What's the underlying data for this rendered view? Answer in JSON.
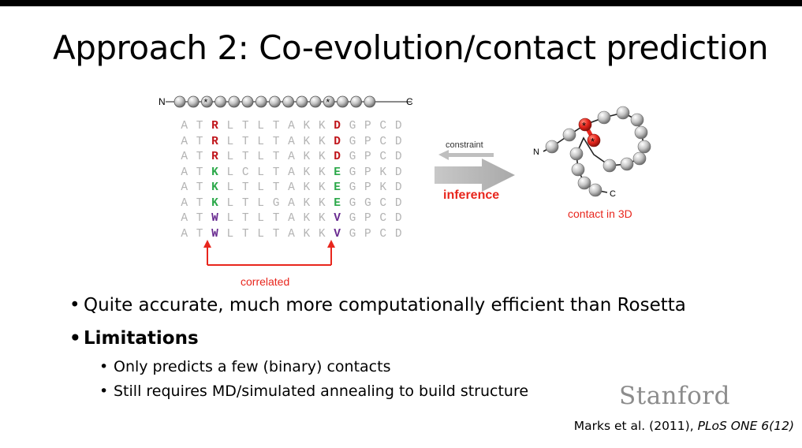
{
  "slide": {
    "title_accent": "Approach 2:",
    "title_rest": " Co-evolution/contact prediction"
  },
  "figure": {
    "chain_n": "N",
    "chain_c": "C",
    "msa_rows": [
      [
        "A",
        "T",
        "R",
        "L",
        "T",
        "L",
        "T",
        "A",
        "K",
        "K",
        "D",
        "G",
        "P",
        "C",
        "D"
      ],
      [
        "A",
        "T",
        "R",
        "L",
        "T",
        "L",
        "T",
        "A",
        "K",
        "K",
        "D",
        "G",
        "P",
        "C",
        "D"
      ],
      [
        "A",
        "T",
        "R",
        "L",
        "T",
        "L",
        "T",
        "A",
        "K",
        "K",
        "D",
        "G",
        "P",
        "C",
        "D"
      ],
      [
        "A",
        "T",
        "K",
        "L",
        "C",
        "L",
        "T",
        "A",
        "K",
        "K",
        "E",
        "G",
        "P",
        "K",
        "D"
      ],
      [
        "A",
        "T",
        "K",
        "L",
        "T",
        "L",
        "T",
        "A",
        "K",
        "K",
        "E",
        "G",
        "P",
        "K",
        "D"
      ],
      [
        "A",
        "T",
        "K",
        "L",
        "T",
        "L",
        "G",
        "A",
        "K",
        "K",
        "E",
        "G",
        "G",
        "C",
        "D"
      ],
      [
        "A",
        "T",
        "W",
        "L",
        "T",
        "L",
        "T",
        "A",
        "K",
        "K",
        "V",
        "G",
        "P",
        "C",
        "D"
      ],
      [
        "A",
        "T",
        "W",
        "L",
        "T",
        "L",
        "T",
        "A",
        "K",
        "K",
        "V",
        "G",
        "P",
        "C",
        "D"
      ]
    ],
    "highlight_colors": {
      "R": "#c0151b",
      "D": "#c0151b",
      "K": "#2ca94a",
      "E": "#2ca94a",
      "W": "#6a2c91",
      "V": "#6a2c91"
    },
    "gray_color": "#b3b3b3",
    "correlated_label": "correlated",
    "constraint_label": "constraint",
    "inference_label": "inference",
    "contact_label": "contact in 3D",
    "structure_n": "N",
    "structure_c": "C",
    "accent_red": "#e8261d"
  },
  "bullets": {
    "b1": "Quite accurate, much more computationally efficient than Rosetta",
    "b2": "Limitations",
    "b2_1": "Only predicts a few (binary) contacts",
    "b2_2": "Still requires MD/simulated annealing to build structure"
  },
  "logo": {
    "text": "Stanford"
  },
  "citation": {
    "authors": "Marks et al. (2011), ",
    "journal": "PLoS ONE 6(12)"
  }
}
